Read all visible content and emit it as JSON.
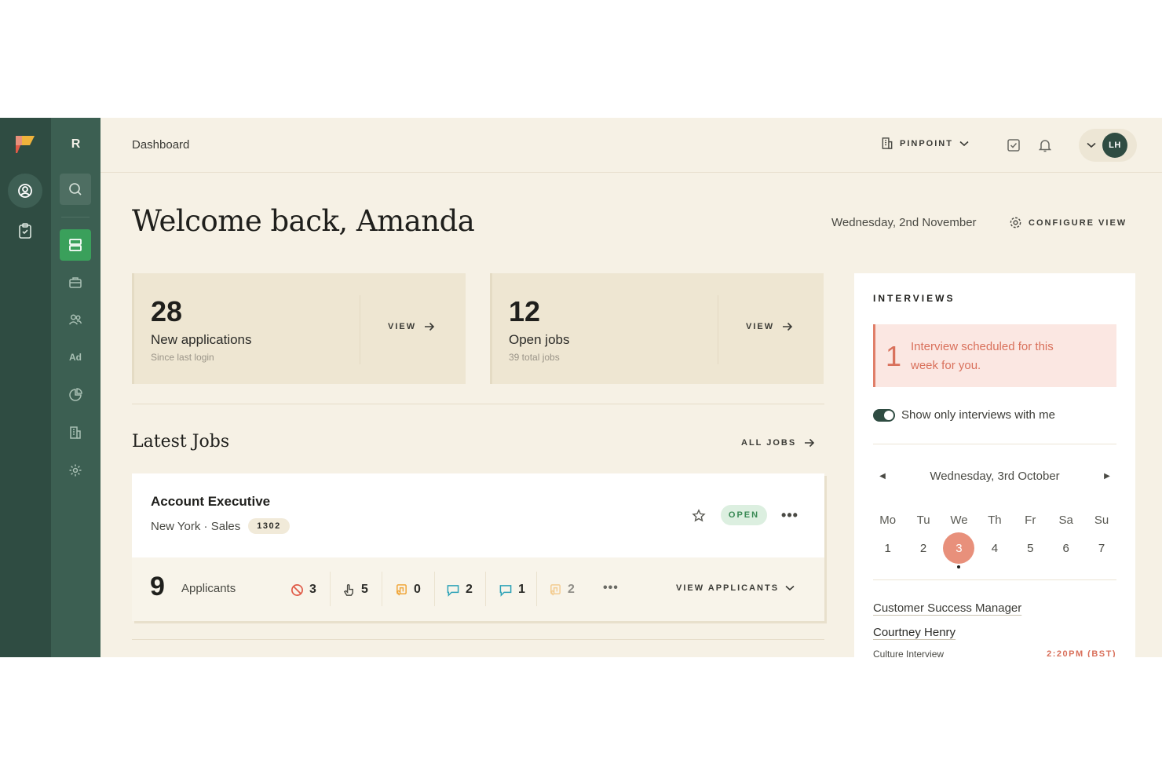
{
  "rail": {
    "workspace_letter": "R",
    "ad_label": "Ad"
  },
  "header": {
    "breadcrumb": "Dashboard",
    "org_name": "PINPOINT",
    "user_initials": "LH"
  },
  "welcome": {
    "title": "Welcome back, Amanda",
    "date": "Wednesday, 2nd November",
    "configure_label": "CONFIGURE VIEW"
  },
  "stats": [
    {
      "value": "28",
      "label": "New applications",
      "sub": "Since last login",
      "action": "VIEW"
    },
    {
      "value": "12",
      "label": "Open jobs",
      "sub": "39 total jobs",
      "action": "VIEW"
    }
  ],
  "latest_jobs": {
    "title": "Latest Jobs",
    "all_label": "ALL JOBS",
    "job": {
      "title": "Account Executive",
      "location": "New York",
      "department": "Sales",
      "separator": "·",
      "id": "1302",
      "status": "OPEN",
      "applicants_count": "9",
      "applicants_label": "Applicants",
      "pipeline": [
        "3",
        "5",
        "0",
        "2",
        "1",
        "2"
      ],
      "more": "•••",
      "view_applicants": "VIEW APPLICANTS"
    }
  },
  "interviews": {
    "title": "INTERVIEWS",
    "alert_count": "1",
    "alert_text": "Interview scheduled for this week for you.",
    "toggle_label": "Show only interviews with me",
    "calendar_title": "Wednesday, 3rd October",
    "weekdays": [
      "Mo",
      "Tu",
      "We",
      "Th",
      "Fr",
      "Sa",
      "Su"
    ],
    "days": [
      "1",
      "2",
      "3",
      "4",
      "5",
      "6",
      "7"
    ],
    "selected_day": "3",
    "item": {
      "job": "Customer Success Manager",
      "candidate": "Courtney Henry",
      "type": "Culture Interview",
      "time": "2:20PM (BST)"
    }
  },
  "colors": {
    "rail_dark": "#2f4c42",
    "rail_light": "#3c5f52",
    "accent_green": "#3aa05b",
    "background": "#f6f1e5",
    "accent_coral": "#e8907b"
  }
}
